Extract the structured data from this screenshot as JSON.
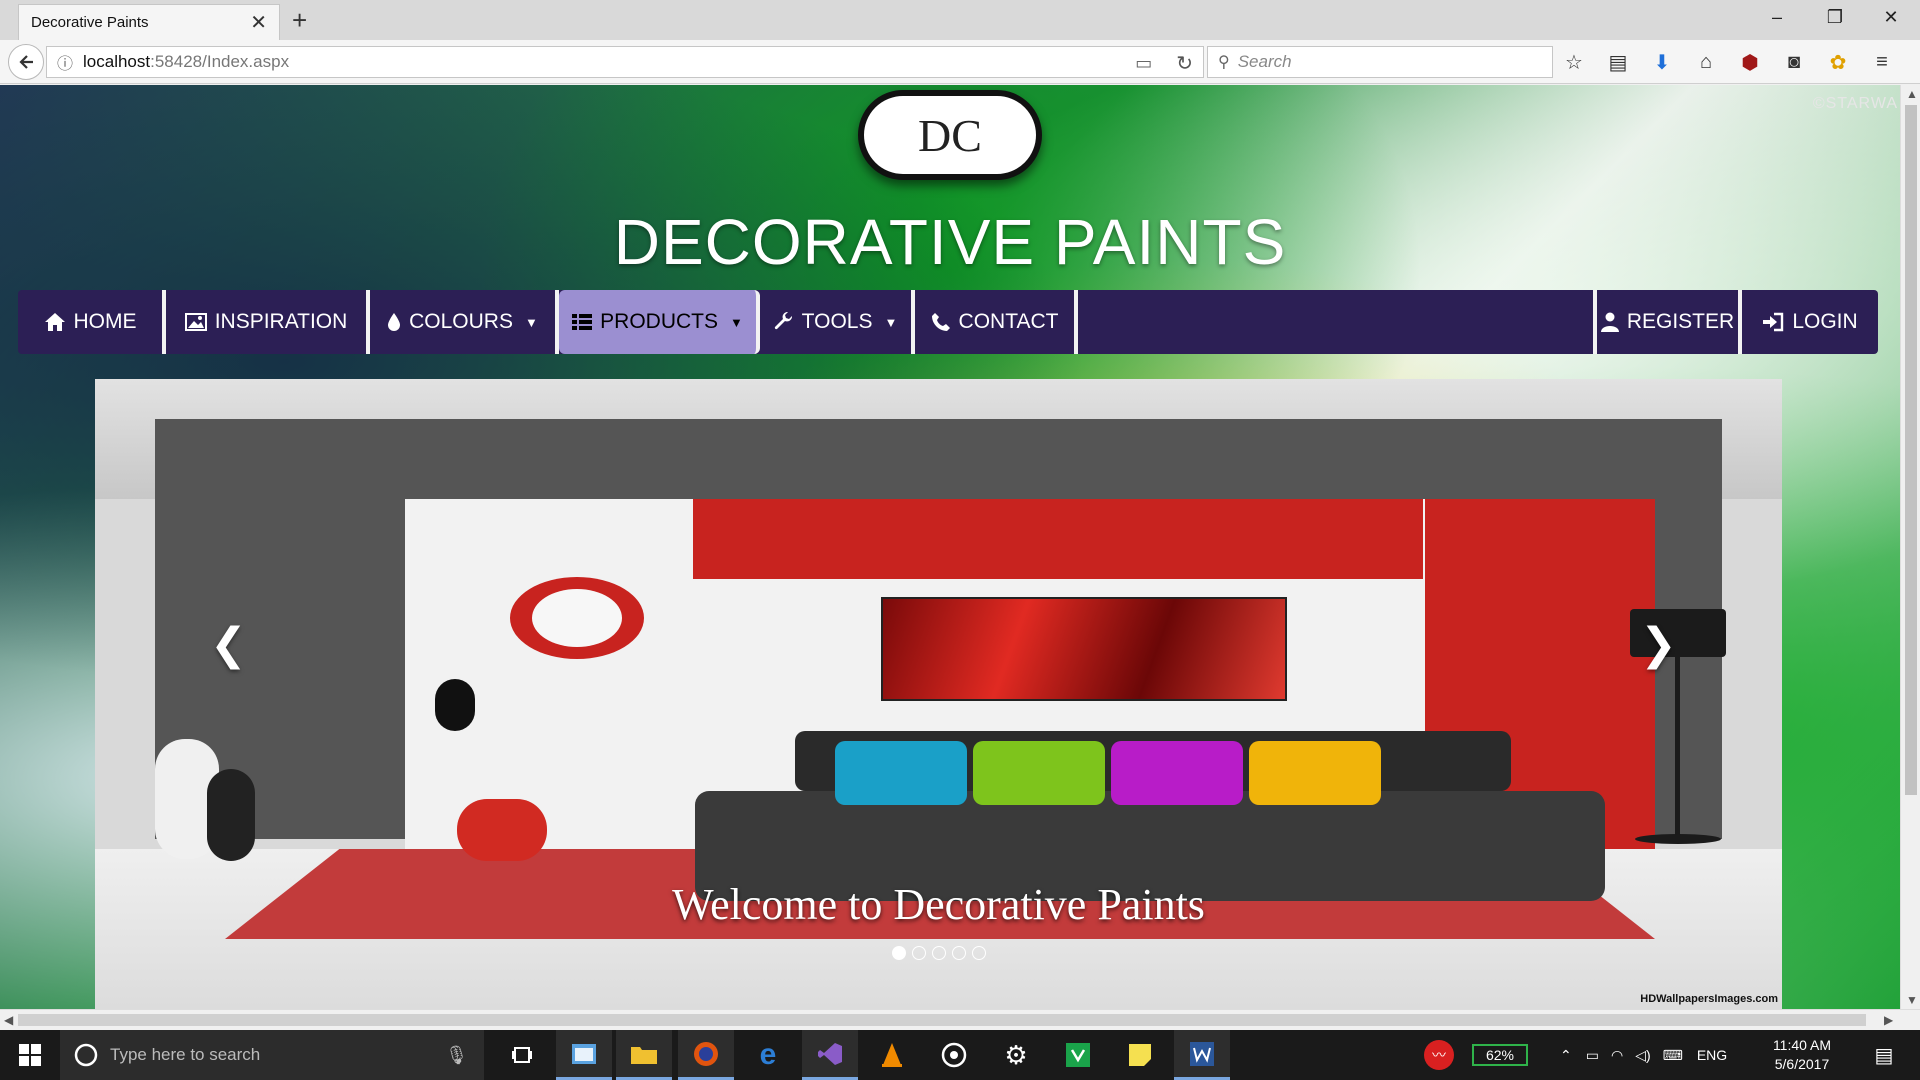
{
  "browser": {
    "tab_title": "Decorative Paints",
    "url_host": "localhost",
    "url_rest": ":58428/Index.aspx",
    "search_placeholder": "Search"
  },
  "site": {
    "logo_text": "DC",
    "title": "DECORATIVE PAINTS",
    "watermark": "©STARWA",
    "nav": [
      {
        "label": "HOME",
        "icon": "home-icon"
      },
      {
        "label": "INSPIRATION",
        "icon": "picture-icon"
      },
      {
        "label": "COLOURS",
        "icon": "drop-icon",
        "dropdown": true
      },
      {
        "label": "PRODUCTS",
        "icon": "list-icon",
        "dropdown": true,
        "active": true
      },
      {
        "label": "TOOLS",
        "icon": "wrench-icon",
        "dropdown": true
      },
      {
        "label": "CONTACT",
        "icon": "phone-icon"
      }
    ],
    "nav_right": [
      {
        "label": "REGISTER",
        "icon": "user-icon"
      },
      {
        "label": "LOGIN",
        "icon": "login-icon"
      }
    ],
    "carousel": {
      "caption": "Welcome to Decorative Paints",
      "slide_count": 5,
      "active_index": 0,
      "credit": "HDWallpapersImages.com"
    }
  },
  "taskbar": {
    "search_placeholder": "Type here to search",
    "battery": "62%",
    "language": "ENG",
    "time": "11:40 AM",
    "date": "5/6/2017"
  },
  "colors": {
    "nav_bg": "#2c1f55",
    "nav_active": "#9b8fd1"
  }
}
